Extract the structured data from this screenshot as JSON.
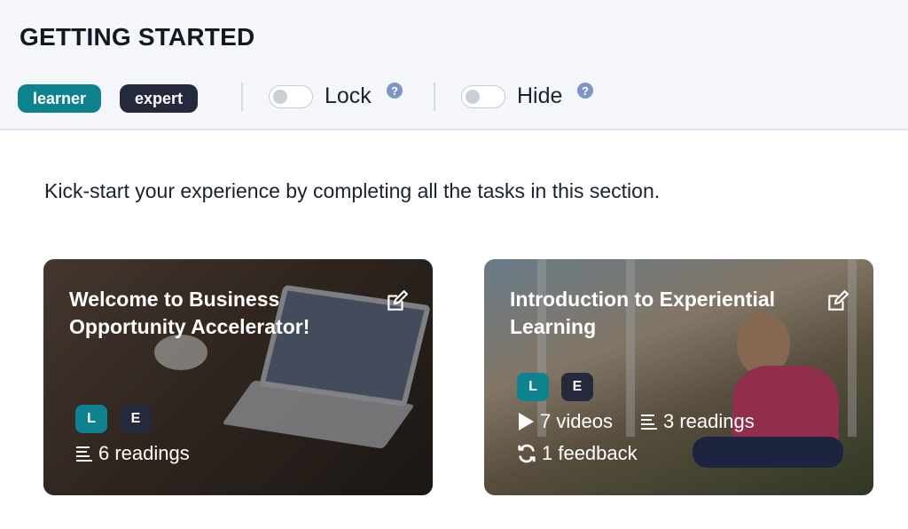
{
  "header": {
    "title": "GETTING STARTED",
    "role_pills": {
      "learner": "learner",
      "expert": "expert"
    },
    "lock": {
      "label": "Lock",
      "help": "?"
    },
    "hide": {
      "label": "Hide",
      "help": "?"
    }
  },
  "intro": "Kick-start your experience by completing all the tasks in this section.",
  "cards": [
    {
      "title": "Welcome to Business Opportunity Accelerator!",
      "badges": {
        "l": "L",
        "e": "E"
      },
      "readings": "6 readings"
    },
    {
      "title": "Introduction to Experiential Learning",
      "badges": {
        "l": "L",
        "e": "E"
      },
      "videos": "7 videos",
      "readings": "3 readings",
      "feedback": "1 feedback"
    }
  ],
  "colors": {
    "teal": "#0f8290",
    "navy": "#242a3c",
    "help_blue": "#7f96c4"
  },
  "icons": [
    "edit-icon",
    "readings-icon",
    "play-icon",
    "feedback-icon",
    "help-icon"
  ]
}
